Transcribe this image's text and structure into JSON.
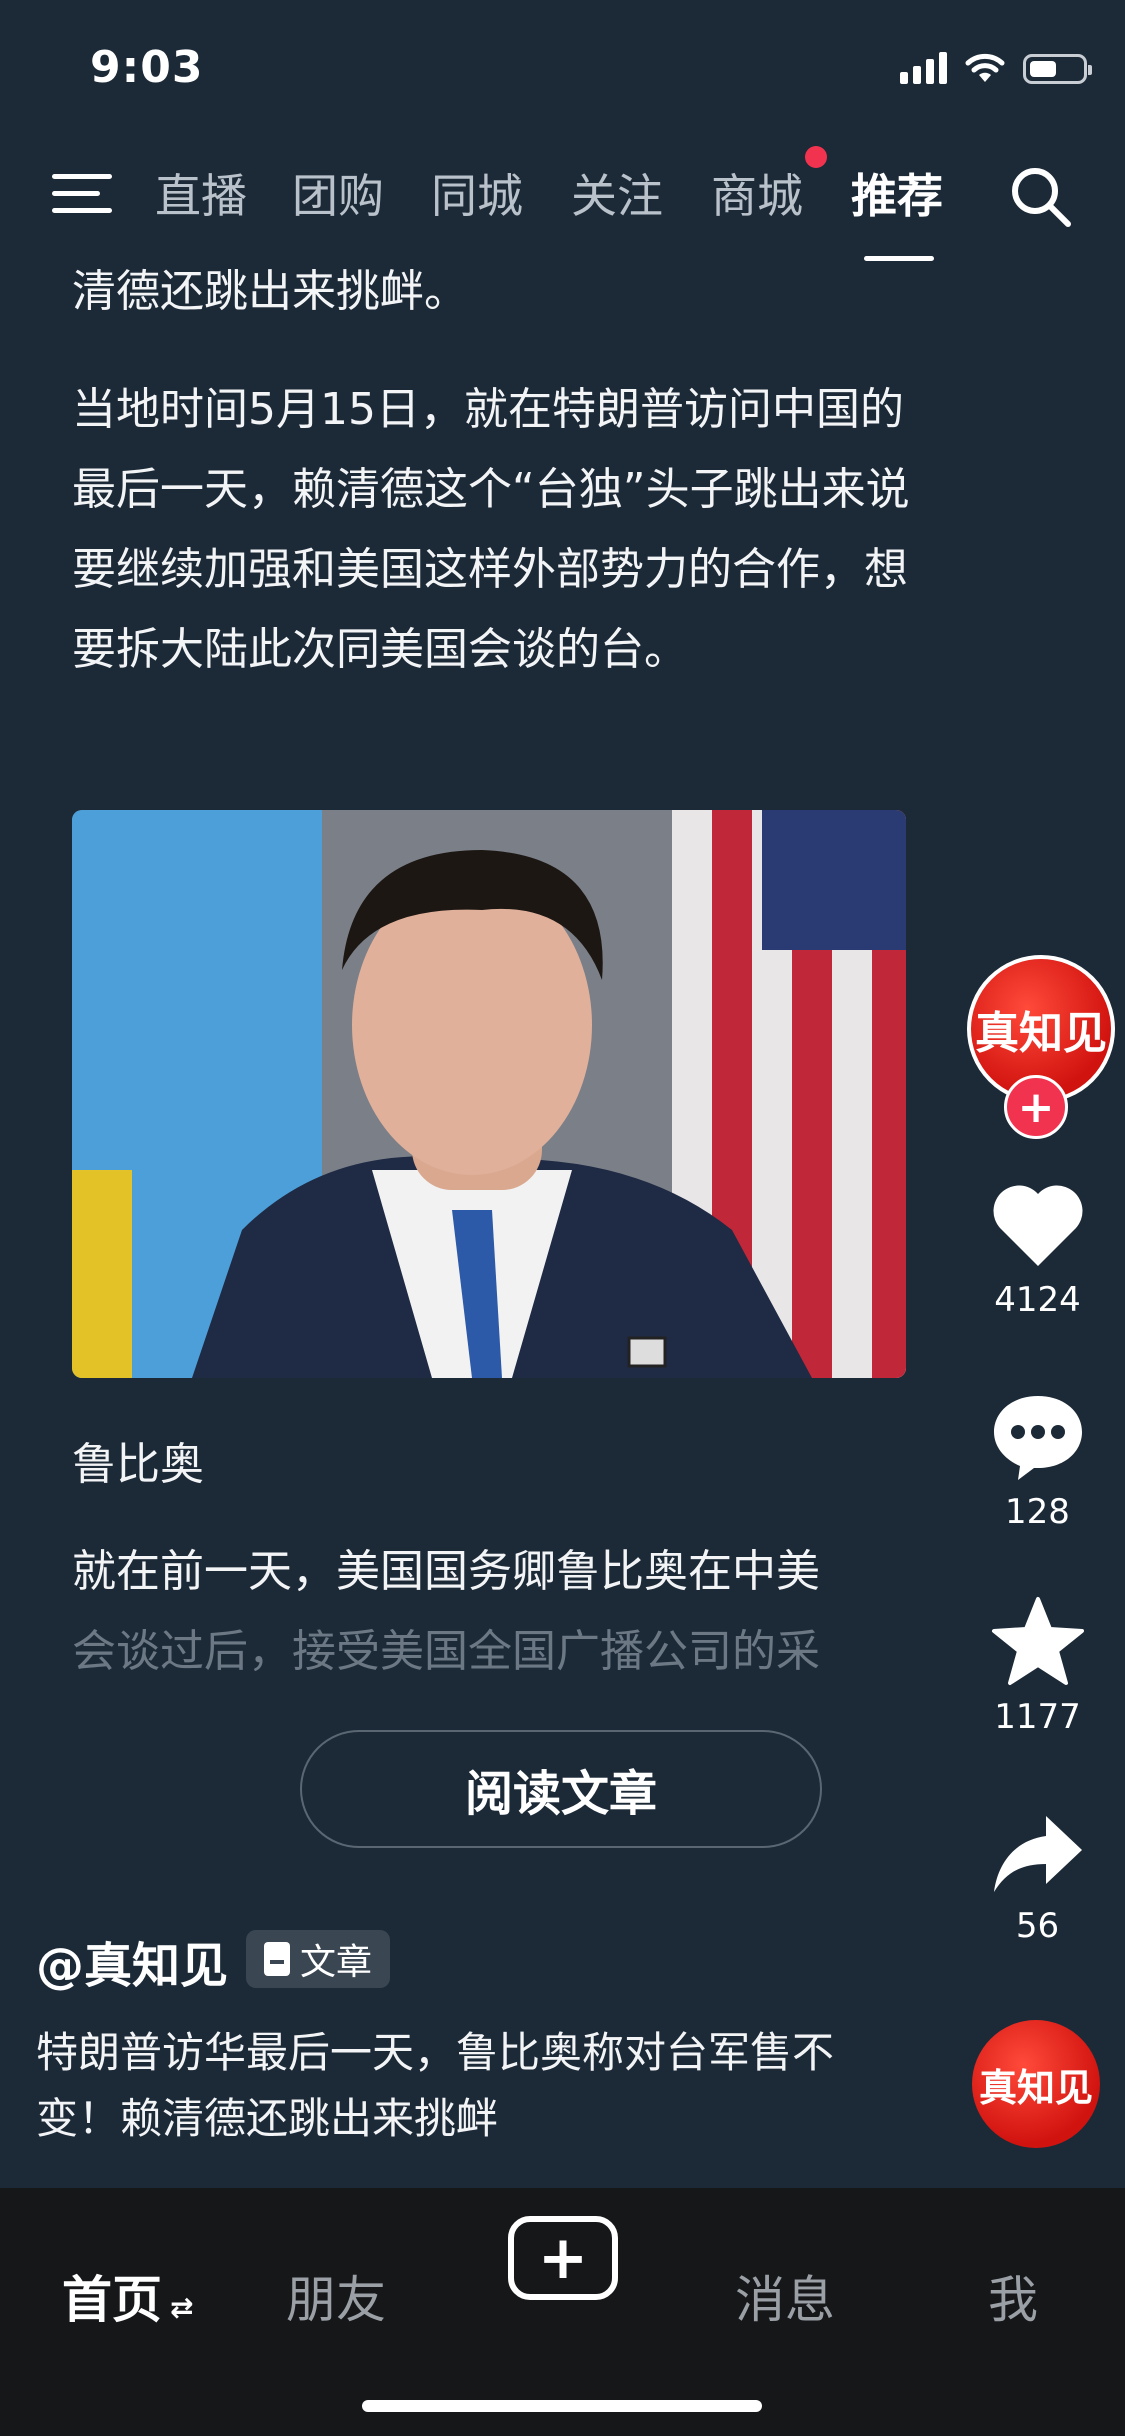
{
  "status_bar": {
    "time": "9:03"
  },
  "top_nav": {
    "tabs": [
      "直播",
      "团购",
      "同城",
      "关注",
      "商城",
      "推荐"
    ],
    "active_tab": "推荐"
  },
  "article": {
    "paragraph1_tail": "清德还跳出来挑衅。",
    "paragraph2": "当地时间5月15日，就在特朗普访问中国的最后一天，赖清德这个“台独”头子跳出来说要继续加强和美国这样外部势力的合作，想要拆大陆此次同美国会谈的台。",
    "image_caption": "鲁比奥",
    "paragraph3": "就在前一天，美国国务卿鲁比奥在中美",
    "paragraph3_faded": "会谈过后，接受美国全国广播公司的采",
    "read_button": "阅读文章"
  },
  "actions": {
    "avatar_text": "真知见",
    "likes": "4124",
    "comments": "128",
    "favorites": "1177",
    "shares": "56"
  },
  "author": {
    "handle": "@真知见",
    "badge": "文章"
  },
  "video_title": "特朗普访华最后一天，鲁比奥称对台军售不变！赖清德还跳出来挑衅",
  "bottom_nav": {
    "home": "首页",
    "friends": "朋友",
    "messages": "消息",
    "me": "我"
  }
}
